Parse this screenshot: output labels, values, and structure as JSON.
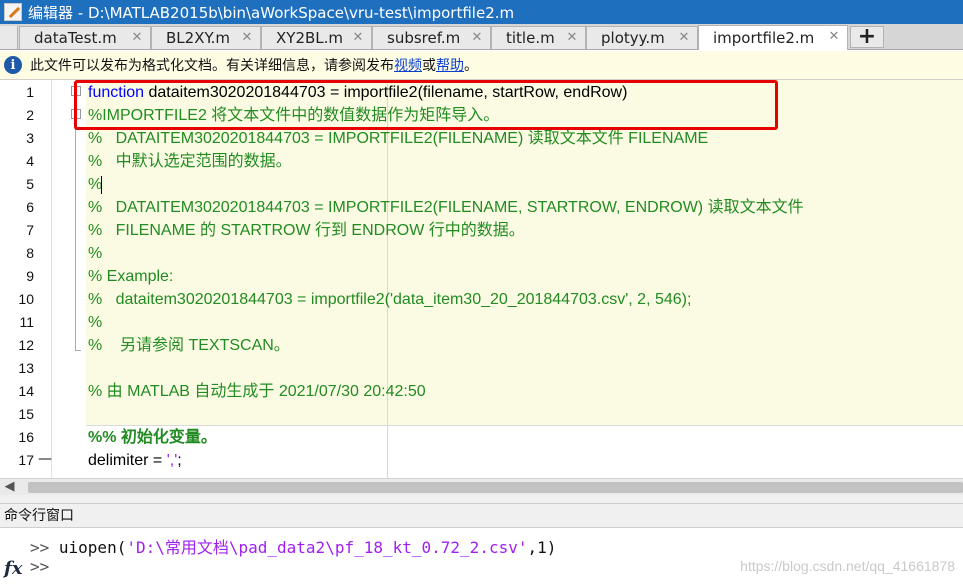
{
  "window": {
    "title": "编辑器 - D:\\MATLAB2015b\\bin\\aWorkSpace\\vru-test\\importfile2.m"
  },
  "tabs": [
    {
      "label": "dataTest.m"
    },
    {
      "label": "BL2XY.m"
    },
    {
      "label": "XY2BL.m"
    },
    {
      "label": "subsref.m"
    },
    {
      "label": "title.m"
    },
    {
      "label": "plotyy.m"
    },
    {
      "label": "importfile2.m",
      "active": true
    }
  ],
  "tab_add_label": "+",
  "infobar": {
    "text": "此文件可以发布为格式化文档。有关详细信息，请参阅发布 ",
    "link1": "视频",
    "middle": " 或 ",
    "link2": "帮助",
    "end": "。"
  },
  "editor": {
    "line_numbers": [
      "1",
      "2",
      "3",
      "4",
      "5",
      "6",
      "7",
      "8",
      "9",
      "10",
      "11",
      "12",
      "13",
      "14",
      "15",
      "16",
      "17"
    ],
    "lines": {
      "l1_kw": "function",
      "l1_rest": " dataitem3020201844703 = importfile2(filename, startRow, endRow)",
      "l2": "%IMPORTFILE2 将文本文件中的数值数据作为矩阵导入。",
      "l3": "%   DATAITEM3020201844703 = IMPORTFILE2(FILENAME) 读取文本文件 FILENAME",
      "l4": "%   中默认选定范围的数据。",
      "l5": "%",
      "l6": "%   DATAITEM3020201844703 = IMPORTFILE2(FILENAME, STARTROW, ENDROW) 读取文本文件",
      "l7": "%   FILENAME 的 STARTROW 行到 ENDROW 行中的数据。",
      "l8": "%",
      "l9": "% Example:",
      "l10": "%   dataitem3020201844703 = importfile2('data_item30_20_201844703.csv', 2, 546);",
      "l11": "%",
      "l12": "%    另请参阅 TEXTSCAN。",
      "l13": "",
      "l14": "% 由 MATLAB 自动生成于 2021/07/30 20:42:50",
      "l15": "",
      "l16": "%% 初始化变量。",
      "l17_a": "delimiter = ",
      "l17_str": "','",
      "l17_b": ";"
    }
  },
  "command_window": {
    "header": "命令行窗口",
    "prompt": ">>",
    "cmd1_a": " uiopen(",
    "cmd1_str": "'D:\\常用文档\\pad_data2\\pf_18_kt_0.72_2.csv'",
    "cmd1_b": ",1)",
    "fx_label": "fx",
    "watermark": "https://blog.csdn.net/qq_41661878"
  },
  "colors": {
    "titlebar": "#1f6fbf",
    "keyword": "#0000ff",
    "comment": "#228b22",
    "string": "#a020f0",
    "highlight_box": "#e60000",
    "cell_background": "#fbfbe3"
  }
}
